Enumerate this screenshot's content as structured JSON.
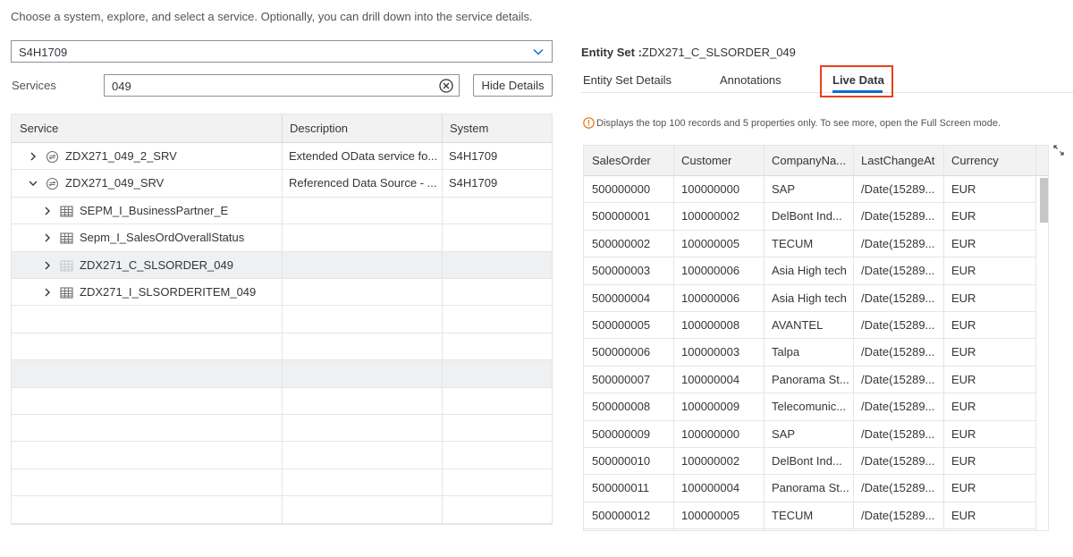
{
  "intro": "Choose a system, explore, and select a service. Optionally, you can drill down into the service details.",
  "system_select": {
    "value": "S4H1709"
  },
  "services": {
    "label": "Services",
    "search_value": "049",
    "hide_details_label": "Hide Details"
  },
  "tree": {
    "columns": [
      "Service",
      "Description",
      "System"
    ],
    "rows": [
      {
        "name": "ZDX271_049_2_SRV",
        "description": "Extended OData service fo...",
        "system": "S4H1709",
        "level": 0,
        "expanded": false,
        "icon": "service-icon"
      },
      {
        "name": "ZDX271_049_SRV",
        "description": "Referenced Data Source - ...",
        "system": "S4H1709",
        "level": 0,
        "expanded": true,
        "icon": "service-icon"
      },
      {
        "name": "SEPM_I_BusinessPartner_E",
        "description": "",
        "system": "",
        "level": 1,
        "expanded": false,
        "icon": "table-icon"
      },
      {
        "name": "Sepm_I_SalesOrdOverallStatus",
        "description": "",
        "system": "",
        "level": 1,
        "expanded": false,
        "icon": "table-icon"
      },
      {
        "name": "ZDX271_C_SLSORDER_049",
        "description": "",
        "system": "",
        "level": 1,
        "expanded": false,
        "icon": "table-icon",
        "selected": true
      },
      {
        "name": "ZDX271_I_SLSORDERITEM_049",
        "description": "",
        "system": "",
        "level": 1,
        "expanded": false,
        "icon": "table-icon"
      }
    ]
  },
  "entity_set": {
    "label": "Entity Set :",
    "value": "ZDX271_C_SLSORDER_049"
  },
  "tabs": [
    {
      "label": "Entity Set Details",
      "active": false
    },
    {
      "label": "Annotations",
      "active": false
    },
    {
      "label": "Live Data",
      "active": true
    }
  ],
  "info": "Displays the top 100 records and 5 properties only. To see more, open the Full Screen mode.",
  "live_data": {
    "columns": [
      "SalesOrder",
      "Customer",
      "CompanyNa...",
      "LastChangeAt",
      "Currency"
    ],
    "rows": [
      [
        "500000000",
        "100000000",
        "SAP",
        "/Date(15289...",
        "EUR"
      ],
      [
        "500000001",
        "100000002",
        "DelBont Ind...",
        "/Date(15289...",
        "EUR"
      ],
      [
        "500000002",
        "100000005",
        "TECUM",
        "/Date(15289...",
        "EUR"
      ],
      [
        "500000003",
        "100000006",
        "Asia High tech",
        "/Date(15289...",
        "EUR"
      ],
      [
        "500000004",
        "100000006",
        "Asia High tech",
        "/Date(15289...",
        "EUR"
      ],
      [
        "500000005",
        "100000008",
        "AVANTEL",
        "/Date(15289...",
        "EUR"
      ],
      [
        "500000006",
        "100000003",
        "Talpa",
        "/Date(15289...",
        "EUR"
      ],
      [
        "500000007",
        "100000004",
        "Panorama St...",
        "/Date(15289...",
        "EUR"
      ],
      [
        "500000008",
        "100000009",
        "Telecomunic...",
        "/Date(15289...",
        "EUR"
      ],
      [
        "500000009",
        "100000000",
        "SAP",
        "/Date(15289...",
        "EUR"
      ],
      [
        "500000010",
        "100000002",
        "DelBont Ind...",
        "/Date(15289...",
        "EUR"
      ],
      [
        "500000011",
        "100000004",
        "Panorama St...",
        "/Date(15289...",
        "EUR"
      ],
      [
        "500000012",
        "100000005",
        "TECUM",
        "/Date(15289...",
        "EUR"
      ]
    ]
  },
  "colors": {
    "accent": "#0a6ed1",
    "highlight": "#e8401c",
    "warning": "#e9730c"
  }
}
